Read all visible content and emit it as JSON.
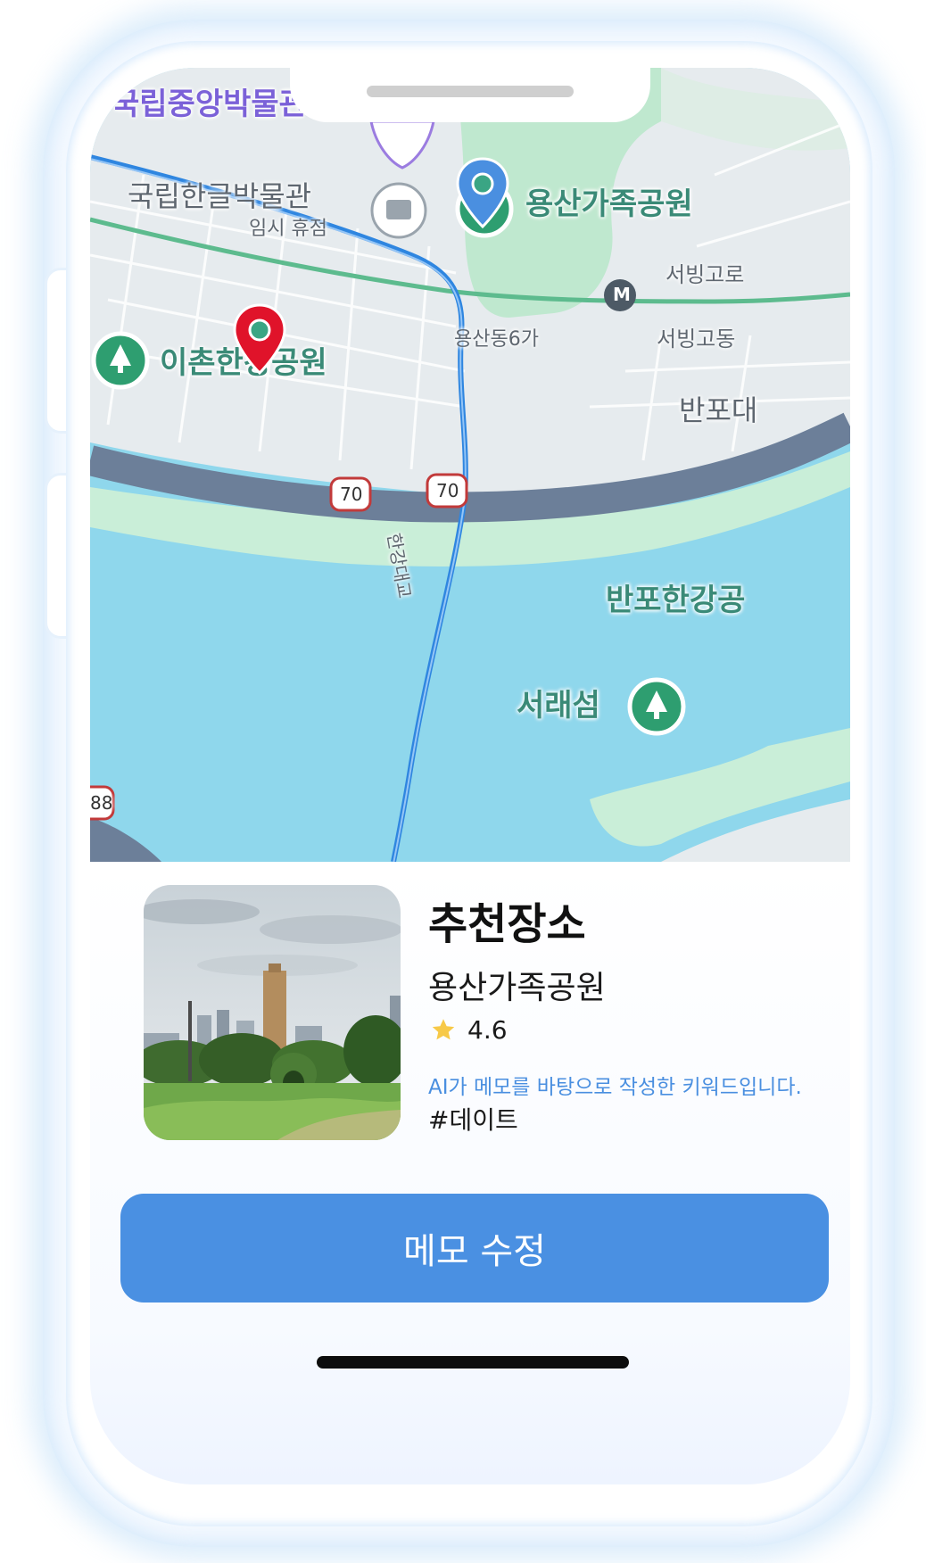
{
  "map": {
    "labels": {
      "museum_national": "국립중앙박물관",
      "hangeul_museum": "국립한글박물관",
      "hangeul_museum_status": "임시 휴점",
      "yongsan_family_park": "용산가족공원",
      "seobinggo_1": "서빙고로",
      "seobinggo_2": "서빙고동",
      "yongsan_6ga": "용산동6가",
      "ichon_park": "이촌한강공원",
      "banpo_bridge": "반포대",
      "banpo_park": "반포한강공",
      "seorae_island": "서래섬",
      "road_70a": "70",
      "road_70b": "70",
      "road_88": "88",
      "bridge_name": "한강대교",
      "metro": "M"
    },
    "colors": {
      "water": "#8fd7ec",
      "land": "#e7ecef",
      "park": "#bfe8cf",
      "road_blue": "#2f86e0",
      "pin_red": "#e0132a",
      "pin_blue": "#4a8fe0"
    }
  },
  "card": {
    "title": "추천장소",
    "place_name": "용산가족공원",
    "rating": "4.6",
    "ai_note": "AI가 메모를 바탕으로 작성한 키워드입니다.",
    "tag": "#데이트"
  },
  "actions": {
    "edit_memo_label": "메모 수정"
  },
  "theme": {
    "accent": "#4a90e2",
    "star": "#f7c948"
  }
}
